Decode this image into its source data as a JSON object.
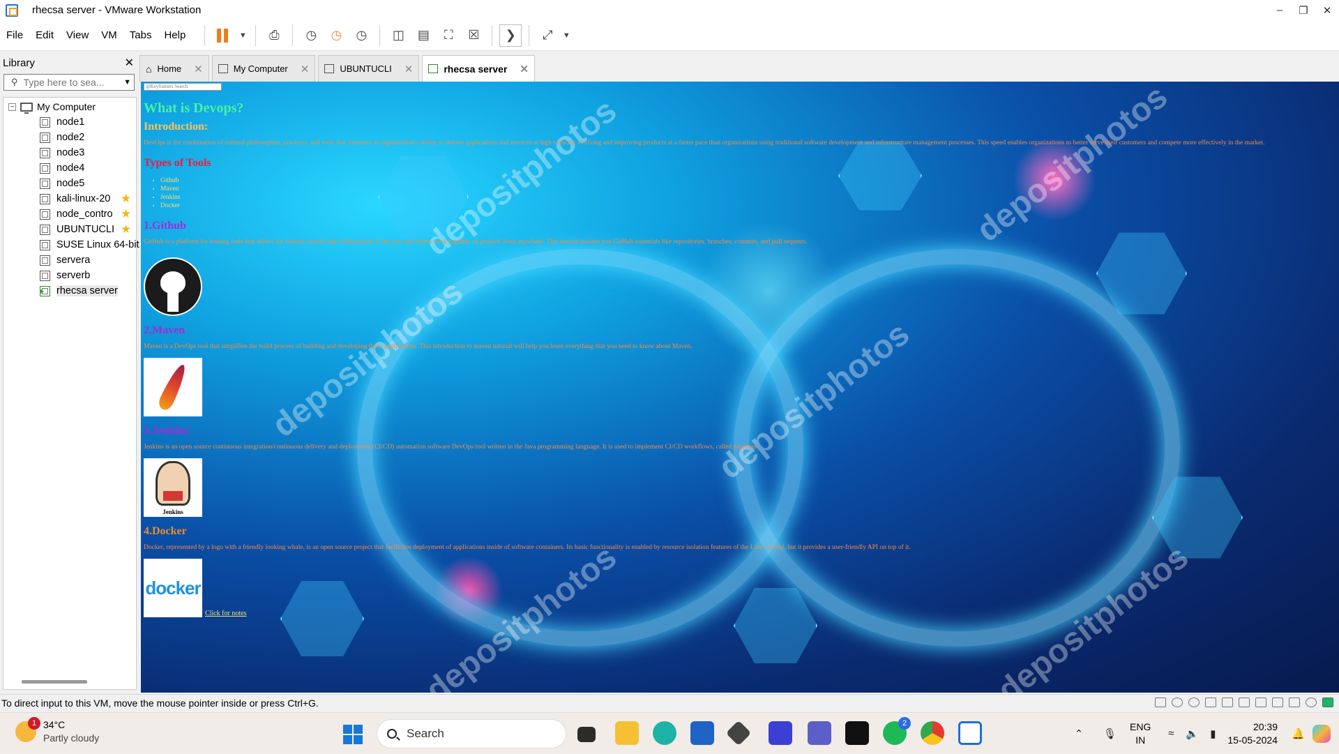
{
  "window": {
    "title": "rhecsa server - VMware Workstation"
  },
  "menu": [
    "File",
    "Edit",
    "View",
    "VM",
    "Tabs",
    "Help"
  ],
  "library": {
    "title": "Library",
    "search_placeholder": "Type here to sea...",
    "root": "My Computer",
    "items": [
      {
        "label": "node1",
        "star": false,
        "running": false
      },
      {
        "label": "node2",
        "star": false,
        "running": false
      },
      {
        "label": "node3",
        "star": false,
        "running": false
      },
      {
        "label": "node4",
        "star": false,
        "running": false
      },
      {
        "label": "node5",
        "star": false,
        "running": false
      },
      {
        "label": "kali-linux-20",
        "star": true,
        "running": false
      },
      {
        "label": "node_contro",
        "star": true,
        "running": false
      },
      {
        "label": "UBUNTUCLI",
        "star": true,
        "running": false
      },
      {
        "label": "SUSE Linux 64-bit",
        "star": false,
        "running": false
      },
      {
        "label": "servera",
        "star": false,
        "running": false
      },
      {
        "label": "serverb",
        "star": false,
        "running": false
      },
      {
        "label": "rhecsa server",
        "star": false,
        "running": true
      }
    ]
  },
  "tabs": [
    {
      "label": "Home",
      "active": false
    },
    {
      "label": "My Computer",
      "active": false
    },
    {
      "label": "UBUNTUCLI",
      "active": false
    },
    {
      "label": "rhecsa server",
      "active": true
    }
  ],
  "guest_page": {
    "search_placeholder": "@Keyframers Search",
    "heading": "What is Devops?",
    "intro_heading": "Introduction:",
    "intro_text": "DevOps is the combination of cultural philosophies, practices, and tools that increases an organization's ability to deliver applications and services at high velocity: evolving and improving products at a faster pace than organizations using traditional software development and infrastructure management processes. This speed enables organizations to better serve their customers and compete more effectively in the market.",
    "tools_heading": "Types of Tools",
    "tools": [
      "Github",
      "Maven",
      "Jenkins",
      "Docker"
    ],
    "github_heading": "1.Github",
    "github_text": "GitHub is a platform for hosting code that allows for version control and collaboration. It lets you and others work together on projects from anywhere. This tutorial teaches you GitHub essentials like repositories, branches, commits, and pull requests.",
    "maven_heading": "2.Maven",
    "maven_text": "Maven is a DevOps tool that simplifies the build process of building and developing these applications. This introduction to maven tutorial will help you learn everything that you need to know about Maven.",
    "jenkins_heading": "3.Jenkins",
    "jenkins_text": "Jenkins is an open source continuous integration/continuous delivery and deployment (CI/CD) automation software DevOps tool written in the Java programming language. It is used to implement CI/CD workflows, called pipelines.",
    "jenkins_logo_label": "Jenkins",
    "docker_heading": "4.Docker",
    "docker_text": "Docker, represented by a logo with a friendly looking whale, is an open source project that facilitates deployment of applications inside of software containers. Its basic functionality is enabled by resource isolation features of the Linux kernel, but it provides a user-friendly API on top of it.",
    "docker_logo_text": "docker",
    "notes_link": "Click for notes",
    "watermark": "depositphotos"
  },
  "statusbar": {
    "text": "To direct input to this VM, move the mouse pointer inside or press Ctrl+G."
  },
  "taskbar": {
    "weather_temp": "34°C",
    "weather_desc": "Partly cloudy",
    "weather_badge": "1",
    "search_label": "Search",
    "lang_top": "ENG",
    "lang_bottom": "IN",
    "time": "20:39",
    "date": "15-05-2024",
    "whatsapp_badge": "2"
  },
  "colors": {
    "accent": "#1e6fd9",
    "vm_bg": "#0a4fa8",
    "heading": "#49f1a6"
  }
}
